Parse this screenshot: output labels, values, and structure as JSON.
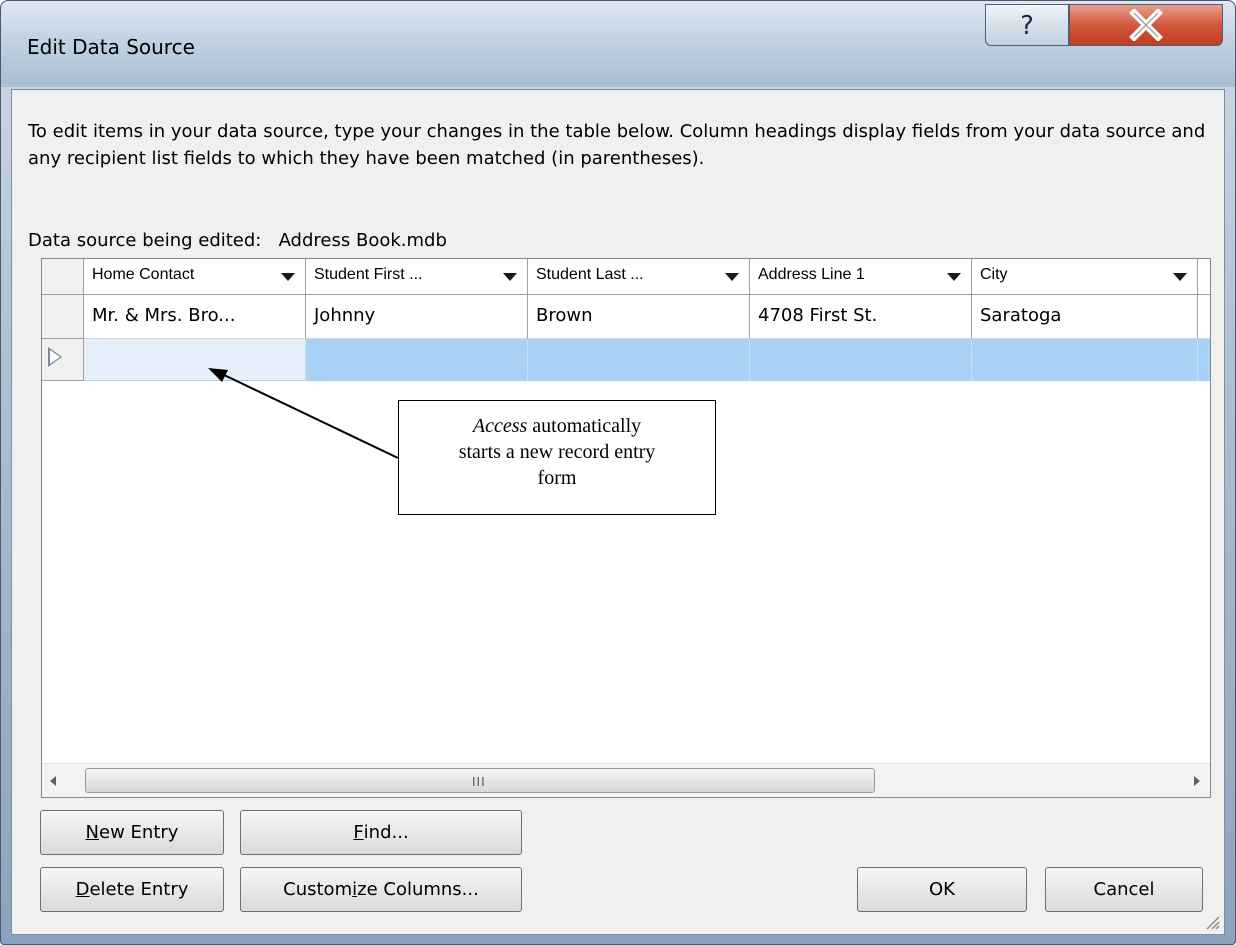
{
  "window": {
    "title": "Edit Data Source",
    "help_label": "?",
    "close_label": "X"
  },
  "instructions": "To edit items in your data source, type your changes in the table below. Column headings display fields from your data source and any recipient list fields to which they have been matched (in parentheses).",
  "data_source": {
    "label": "Data source being edited:",
    "name": "Address Book.mdb"
  },
  "table": {
    "columns": [
      "Home Contact",
      "Student First ...",
      "Student Last ...",
      "Address Line 1",
      "City"
    ],
    "rows": [
      [
        "Mr. & Mrs. Bro...",
        "Johnny",
        "Brown",
        "4708 First St.",
        "Saratoga"
      ]
    ],
    "scroll_grip": "III"
  },
  "callout": {
    "line1_italic": "Access",
    "line1_rest": " automatically",
    "line2": "starts a new record entry",
    "line3": "form"
  },
  "buttons": {
    "new_entry": {
      "accel": "N",
      "rest": "ew Entry"
    },
    "delete_entry": {
      "accel": "D",
      "rest": "elete Entry"
    },
    "find": {
      "accel": "F",
      "rest": "ind..."
    },
    "customize": {
      "pre": "Custom",
      "accel": "i",
      "rest": "ze Columns..."
    },
    "ok": "OK",
    "cancel": "Cancel"
  },
  "colors": {
    "selected_row": "#a9d0f5",
    "close_button": "#c23b1e"
  }
}
